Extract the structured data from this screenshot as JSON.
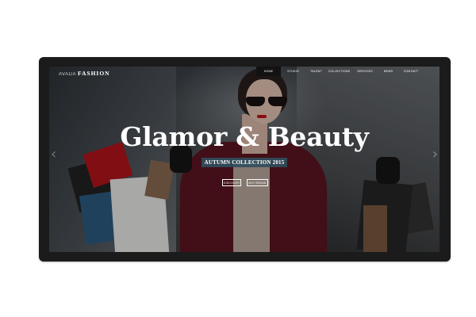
{
  "brand": {
    "light": "AVADA",
    "bold": "FASHION"
  },
  "nav": {
    "items": [
      {
        "label": "Home",
        "active": true
      },
      {
        "label": "Studio",
        "active": false
      },
      {
        "label": "Talent",
        "active": false
      },
      {
        "label": "Collections",
        "active": false
      },
      {
        "label": "Services",
        "active": false
      },
      {
        "label": "News",
        "active": false
      },
      {
        "label": "Contact",
        "active": false
      }
    ]
  },
  "hero": {
    "title": "Glamor & Beauty",
    "subtitle": "AUTUMN COLLECTION 2015",
    "buttons": {
      "discover": "DISCOVER",
      "buy": "BUY BRAND"
    }
  },
  "slider": {
    "prev_icon": "chevron-left-icon",
    "next_icon": "chevron-right-icon"
  },
  "colors": {
    "subtitle_bg": "#304e5c",
    "device_frame": "#1b1b1b",
    "nav_active_bg": "#121212"
  }
}
